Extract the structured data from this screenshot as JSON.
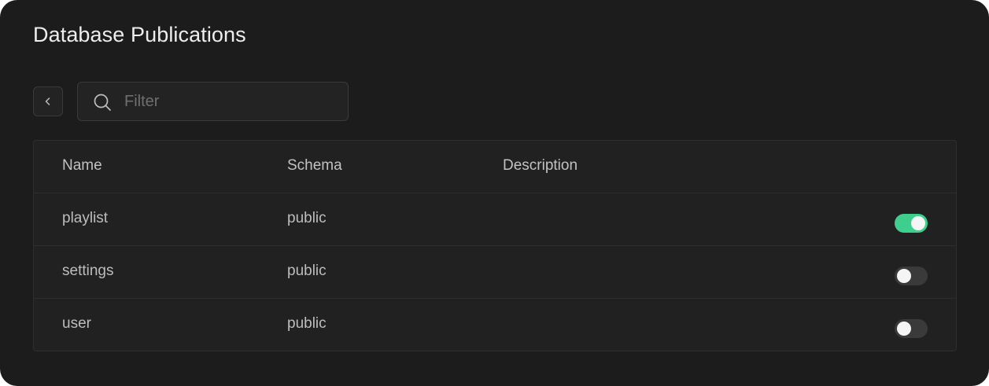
{
  "page": {
    "title": "Database Publications"
  },
  "toolbar": {
    "back_icon": "chevron-left-icon",
    "filter_placeholder": "Filter",
    "filter_value": "",
    "search_icon": "search-icon"
  },
  "table": {
    "columns": [
      "Name",
      "Schema",
      "Description"
    ],
    "rows": [
      {
        "name": "playlist",
        "schema": "public",
        "description": "",
        "enabled": true
      },
      {
        "name": "settings",
        "schema": "public",
        "description": "",
        "enabled": false
      },
      {
        "name": "user",
        "schema": "public",
        "description": "",
        "enabled": false
      }
    ]
  },
  "colors": {
    "panel_bg": "#1c1c1c",
    "toggle_on": "#3ecf8e",
    "toggle_off": "#3a3a3a"
  }
}
